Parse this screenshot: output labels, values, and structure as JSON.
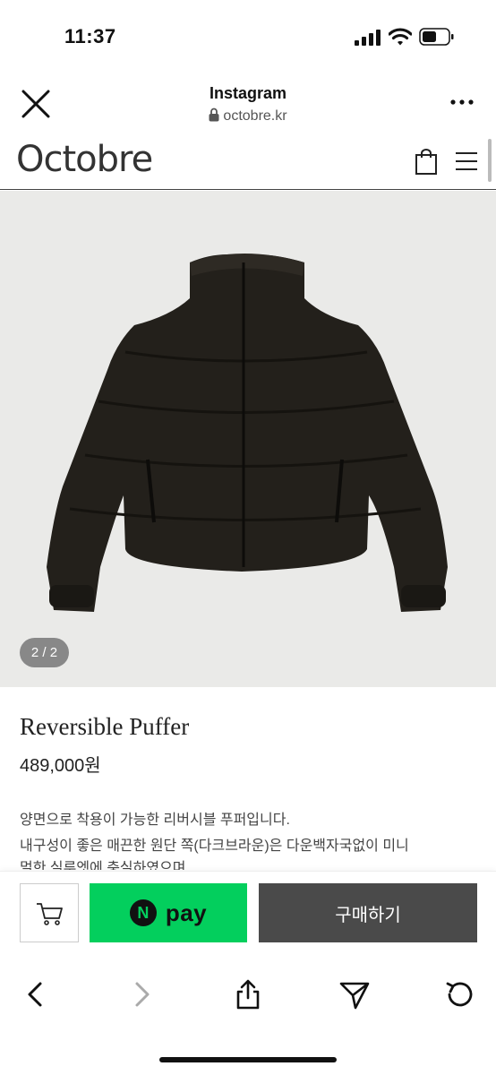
{
  "status_bar": {
    "time": "11:37"
  },
  "browser_header": {
    "title": "Instagram",
    "url": "octobre.kr"
  },
  "site": {
    "logo": "Octobre"
  },
  "product": {
    "image_counter": "2 / 2",
    "name": "Reversible Puffer",
    "price": "489,000원",
    "description": [
      "양면으로 착용이 가능한 리버시블 푸퍼입니다.",
      "내구성이 좋은 매끈한 원단 쪽(다크브라운)은 다운백자국없이 미니",
      "멀한 실루엣에 충실하였으며,"
    ],
    "image_colors": {
      "jacket": "#23201b",
      "background": "#eaeae8"
    }
  },
  "purchase_bar": {
    "npay_badge": "N",
    "npay_label": "pay",
    "buy_label": "구매하기",
    "npay_color": "#03cf5d"
  },
  "toolbar": {
    "icons": [
      "back-icon",
      "forward-icon",
      "share-icon",
      "send-icon",
      "reload-icon"
    ]
  }
}
